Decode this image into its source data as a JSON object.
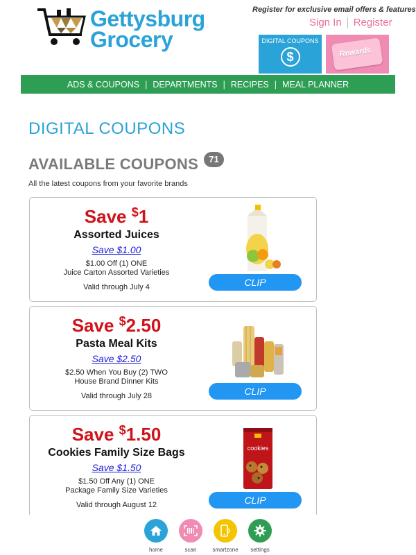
{
  "header": {
    "brand_line1": "Gettysburg",
    "brand_line2": "Grocery",
    "tagline": "Register for exclusive email offers & features",
    "sign_in": "Sign In",
    "register": "Register",
    "promo_digital_coupons": "DIGITAL COUPONS",
    "promo_rewards": "Rewards"
  },
  "nav": {
    "items": [
      "ADS & COUPONS",
      "DEPARTMENTS",
      "RECIPES",
      "MEAL PLANNER"
    ]
  },
  "main": {
    "page_title": "DIGITAL COUPONS",
    "section_title": "AVAILABLE COUPONS",
    "count": "71",
    "subtitle": "All the latest coupons from your favorite brands"
  },
  "coupons": [
    {
      "save_prefix": "Save ",
      "dollar": "$",
      "amount": "1",
      "name": "Assorted Juices",
      "link": "Save $1.00",
      "desc1": "$1.00 Off (1) ONE",
      "desc2": "Juice Carton Assorted Varieties",
      "valid": "Valid through July 4",
      "clip": "CLIP"
    },
    {
      "save_prefix": "Save ",
      "dollar": "$",
      "amount": "2.50",
      "name": "Pasta Meal Kits",
      "link": "Save $2.50",
      "desc1": "$2.50 When You Buy (2) TWO",
      "desc2": "House Brand Dinner Kits",
      "valid": "Valid through July 28",
      "clip": "CLIP"
    },
    {
      "save_prefix": "Save ",
      "dollar": "$",
      "amount": "1.50",
      "name": "Cookies Family Size Bags",
      "link": "Save $1.50",
      "desc1": "$1.50 Off Any (1) ONE",
      "desc2": "Package Family Size Varieties",
      "valid": "Valid through August 12",
      "clip": "CLIP",
      "package_text": "cookies"
    }
  ],
  "bottom_nav": [
    {
      "label": "home",
      "icon": "home-icon",
      "color": "#2aa3d8"
    },
    {
      "label": "scan",
      "icon": "barcode-icon",
      "color": "#f08bb4"
    },
    {
      "label": "smartzone",
      "icon": "phone-icon",
      "color": "#f5c400"
    },
    {
      "label": "settings",
      "icon": "gear-icon",
      "color": "#2e9e54"
    }
  ],
  "colors": {
    "brand_blue": "#2aa3d8",
    "nav_green": "#2e9e54",
    "save_red": "#d0121b",
    "clip_blue": "#2196f3",
    "pink": "#f08bb4"
  }
}
